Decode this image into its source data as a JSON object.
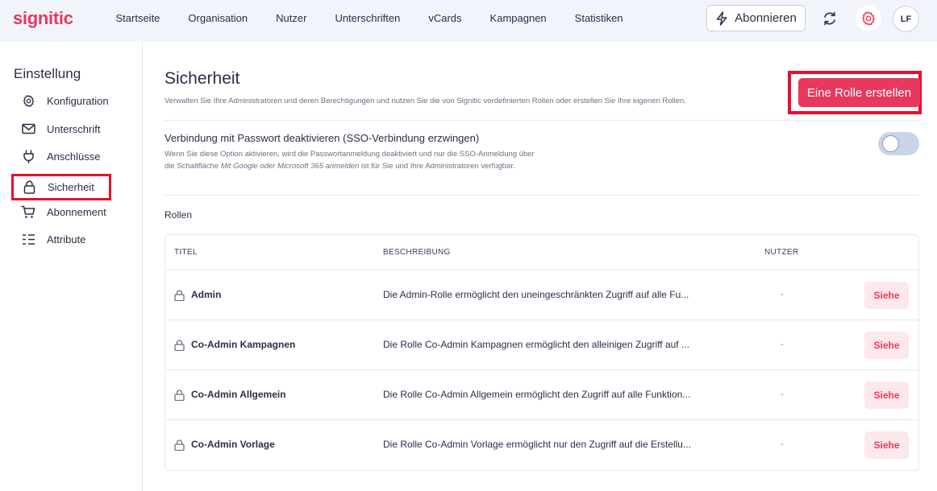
{
  "brand": {
    "logo": "signitic",
    "accent": "#e8385c",
    "highlight": "#e8102e"
  },
  "nav": {
    "items": [
      "Startseite",
      "Organisation",
      "Nutzer",
      "Unterschriften",
      "vCards",
      "Kampagnen",
      "Statistiken"
    ]
  },
  "header": {
    "subscribe_label": "Abonnieren",
    "avatar_initials": "LF",
    "icons": [
      "bolt-icon",
      "refresh-icon",
      "gear-icon"
    ]
  },
  "sidebar": {
    "title": "Einstellung",
    "items": [
      {
        "label": "Konfiguration",
        "icon": "gear-icon"
      },
      {
        "label": "Unterschrift",
        "icon": "mail-icon"
      },
      {
        "label": "Anschlüsse",
        "icon": "plug-icon"
      },
      {
        "label": "Sicherheit",
        "icon": "lock-icon",
        "active": true
      },
      {
        "label": "Abonnement",
        "icon": "cart-icon"
      },
      {
        "label": "Attribute",
        "icon": "list-icon"
      }
    ]
  },
  "main": {
    "title": "Sicherheit",
    "subtitle": "Verwalten Sie Ihre Administratoren und deren Berechtigungen und nutzen Sie die von Signitic vordefinierten Rollen oder erstellen Sie Ihre eigenen Rollen.",
    "create_button": "Eine Rolle erstellen",
    "sso": {
      "title": "Verbindung mit Passwort deaktivieren (SSO-Verbindung erzwingen)",
      "desc_part1": "Wenn Sie diese Option aktivieren, wird die Passwortanmeldung deaktiviert und nur die SSO-Anmeldung über die Schaltfläche ",
      "desc_italic": "Mit Google oder Microsoft 365 anmelden",
      "desc_part2": " ist für Sie und Ihre Administratoren verfügbar.",
      "enabled": false
    },
    "roles_label": "Rollen",
    "table": {
      "headers": [
        "TITEL",
        "BESCHREIBUNG",
        "NUTZER"
      ],
      "rows": [
        {
          "title": "Admin",
          "description": "Die Admin-Rolle ermöglicht den uneingeschränkten Zugriff auf alle Fu...",
          "users": "-",
          "action": "Siehe"
        },
        {
          "title": "Co-Admin Kampagnen",
          "description": "Die Rolle Co-Admin Kampagnen ermöglicht den alleinigen Zugriff auf ...",
          "users": "-",
          "action": "Siehe"
        },
        {
          "title": "Co-Admin Allgemein",
          "description": "Die Rolle Co-Admin Allgemein ermöglicht den Zugriff auf alle Funktion...",
          "users": "-",
          "action": "Siehe"
        },
        {
          "title": "Co-Admin Vorlage",
          "description": "Die Rolle Co-Admin Vorlage ermöglicht nur den Zugriff auf die Erstellu...",
          "users": "-",
          "action": "Siehe"
        }
      ]
    }
  }
}
